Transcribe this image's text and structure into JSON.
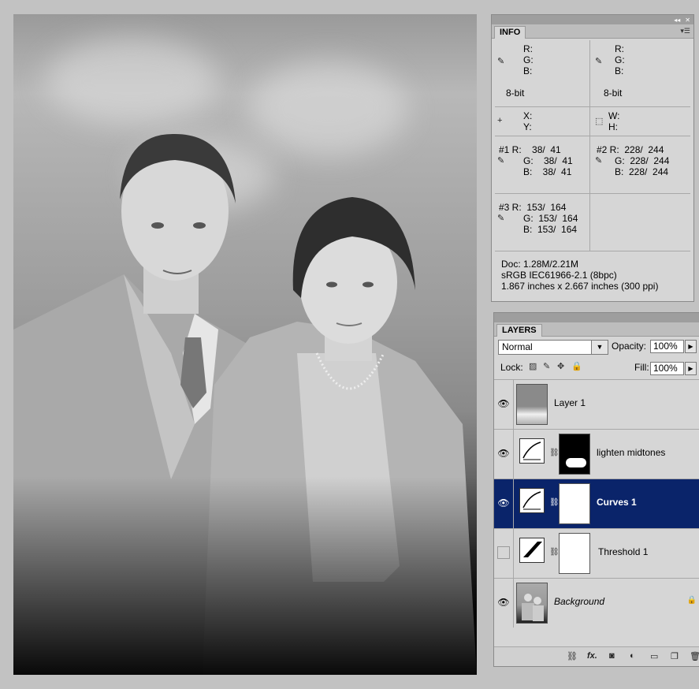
{
  "info_panel": {
    "tab_title": "INFO",
    "color_left": {
      "r": "R:",
      "g": "G:",
      "b": "B:",
      "bits": "8-bit"
    },
    "color_right": {
      "r": "R:",
      "g": "G:",
      "b": "B:",
      "bits": "8-bit"
    },
    "pos": {
      "x": "X:",
      "y": "Y:"
    },
    "size": {
      "w": "W:",
      "h": "H:"
    },
    "sampler1": {
      "r": "#1 R:    38/  41",
      "g": "G:    38/  41",
      "b": "B:    38/  41"
    },
    "sampler2": {
      "r": "#2 R:  228/  244",
      "g": "G:  228/  244",
      "b": "B:  228/  244"
    },
    "sampler3": {
      "r": "#3 R:  153/  164",
      "g": "G:  153/  164",
      "b": "B:  153/  164"
    },
    "doc": "Doc: 1.28M/2.21M",
    "profile": "sRGB IEC61966-2.1 (8bpc)",
    "dimensions": "1.867 inches x 2.667 inches (300 ppi)"
  },
  "layers_panel": {
    "tab_title": "LAYERS",
    "blend_mode": "Normal",
    "opacity_label": "Opacity:",
    "opacity_value": "100%",
    "lock_label": "Lock:",
    "fill_label": "Fill:",
    "fill_value": "100%",
    "layers": [
      {
        "name": "Layer 1",
        "visible": true,
        "selected": false
      },
      {
        "name": "lighten midtones",
        "visible": true,
        "selected": false
      },
      {
        "name": "Curves 1",
        "visible": true,
        "selected": true
      },
      {
        "name": "Threshold 1",
        "visible": false,
        "selected": false
      },
      {
        "name": "Background",
        "visible": true,
        "selected": false,
        "locked": true
      }
    ]
  },
  "icons": {
    "eye": "eye-icon",
    "link": "chain-link-icon",
    "fx": "fx-icon",
    "mask": "add-mask-icon",
    "adjust": "adjustment-layer-icon",
    "folder": "folder-icon",
    "new": "new-layer-icon",
    "trash": "trash-icon"
  },
  "colors": {
    "selection": "#0a246a",
    "panel": "#d6d6d6",
    "workspace": "#c2c2c2"
  }
}
